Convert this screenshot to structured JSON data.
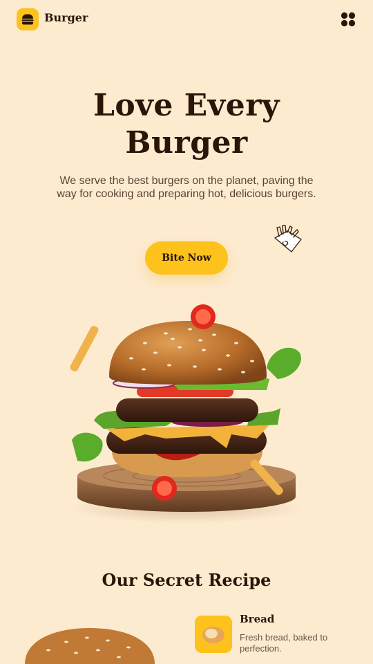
{
  "header": {
    "brand": "Burger",
    "logo_icon": "burger-icon",
    "menu_icon": "grid-menu-icon"
  },
  "hero": {
    "title_line1": "Love Every",
    "title_line2": "Burger",
    "subtitle": "We serve the best burgers on the planet, paving the way for cooking and preparing hot, delicious burgers.",
    "cta_label": "Bite Now",
    "doodle_icon": "fries-icon",
    "illustration": "burger-illustration"
  },
  "recipe": {
    "title": "Our Secret Recipe",
    "items": [
      {
        "name": "Bread",
        "description": "Fresh bread, baked to perfection.",
        "icon": "bread-icon"
      }
    ]
  },
  "colors": {
    "background": "#fdebd0",
    "accent": "#fdc21c",
    "text_dark": "#2a1508",
    "text_muted": "#5a4335"
  }
}
